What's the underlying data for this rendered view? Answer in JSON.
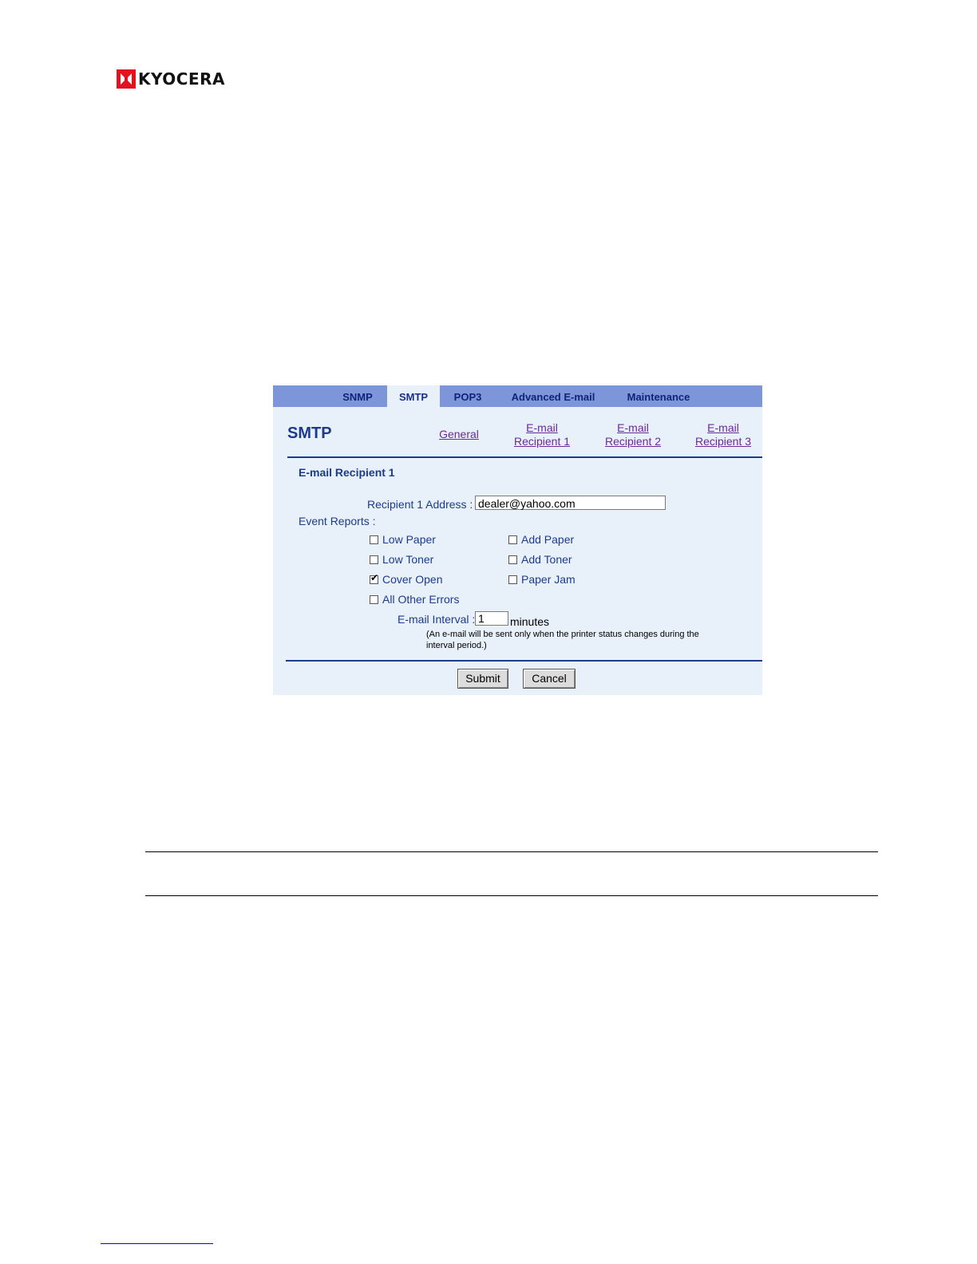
{
  "brand": {
    "name": "KYOCERA",
    "mark_color": "#e3121f"
  },
  "tabs": [
    {
      "label": "SNMP",
      "active": false
    },
    {
      "label": "SMTP",
      "active": true
    },
    {
      "label": "POP3",
      "active": false
    },
    {
      "label": "Advanced E-mail",
      "active": false
    },
    {
      "label": "Maintenance",
      "active": false
    }
  ],
  "page_title": "SMTP",
  "sublinks": [
    {
      "line1": "General",
      "line2": ""
    },
    {
      "line1": "E-mail",
      "line2": "Recipient 1"
    },
    {
      "line1": "E-mail",
      "line2": "Recipient 2"
    },
    {
      "line1": "E-mail",
      "line2": "Recipient 3"
    }
  ],
  "section_title": "E-mail Recipient 1",
  "address": {
    "label": "Recipient 1 Address :",
    "value": "dealer@yahoo.com"
  },
  "event_reports_label": "Event Reports :",
  "checkboxes": [
    {
      "label": "Low Paper",
      "checked": false
    },
    {
      "label": "Add Paper",
      "checked": false
    },
    {
      "label": "Low Toner",
      "checked": false
    },
    {
      "label": "Add Toner",
      "checked": false
    },
    {
      "label": "Cover Open",
      "checked": true
    },
    {
      "label": "Paper Jam",
      "checked": false
    },
    {
      "label": "All Other Errors",
      "checked": false
    }
  ],
  "interval": {
    "label": "E-mail Interval :",
    "value": "1",
    "unit": "minutes"
  },
  "note": "(An e-mail will be sent only when the printer status changes during the interval period.)",
  "buttons": {
    "submit": "Submit",
    "cancel": "Cancel"
  },
  "colors": {
    "tab_bar": "#7d95d9",
    "panel": "#e8f0fa",
    "heading": "#1c3b8e",
    "link": "#6a2a9a"
  }
}
